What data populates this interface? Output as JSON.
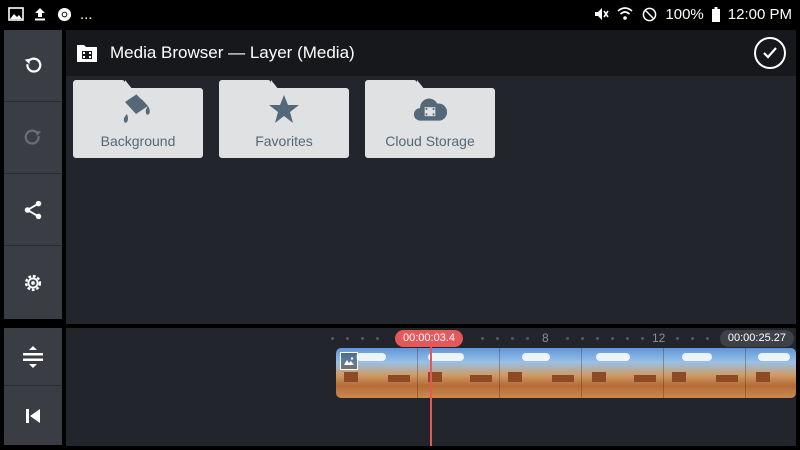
{
  "status_bar": {
    "more": "...",
    "battery_percent": "100%",
    "time": "12:00 PM",
    "icons_left": [
      "gallery-icon",
      "upload-icon",
      "chrome-icon"
    ],
    "icons_right": [
      "mute-icon",
      "wifi-icon",
      "do-not-disturb-icon",
      "battery-icon"
    ]
  },
  "header": {
    "title": "Media Browser — Layer (Media)",
    "icon": "media-folder-icon",
    "confirm_icon": "check-circle-icon"
  },
  "sidebar": {
    "top_buttons": [
      "undo-icon",
      "redo-icon",
      "share-icon",
      "settings-icon"
    ],
    "bottom_buttons": [
      "split-layers-icon",
      "skip-to-start-icon"
    ]
  },
  "folders": [
    {
      "label": "Background",
      "icon": "paint-bucket-icon"
    },
    {
      "label": "Favorites",
      "icon": "star-icon"
    },
    {
      "label": "Cloud Storage",
      "icon": "cloud-film-icon"
    }
  ],
  "timeline": {
    "playhead_time": "00:00:03.4",
    "end_time": "00:00:25.27",
    "ruler_labels": [
      "8",
      "12"
    ]
  },
  "colors": {
    "accent": "#e5585a",
    "panel": "#22252c",
    "header": "#16181c",
    "sidebar": "#3a3d43",
    "folder": "#dfe1e3",
    "folder_text": "#546877"
  }
}
